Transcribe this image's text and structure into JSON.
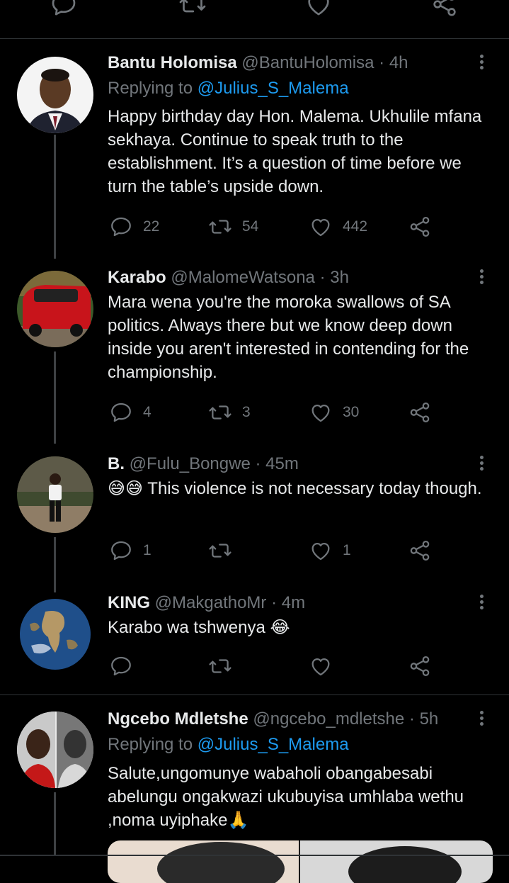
{
  "tweets": [
    {
      "name": "Bantu Holomisa",
      "handle": "@BantuHolomisa",
      "dot": "·",
      "time": "4h",
      "replying_prefix": "Replying to ",
      "replying_to": "@Julius_S_Malema",
      "text": "Happy birthday day Hon. Malema. Ukhulile mfana sekhaya. Continue to speak truth to the establishment. It’s a question of time before we turn the table’s upside down.",
      "replies": "22",
      "retweets": "54",
      "likes": "442",
      "avatar": "portrait-man-suit"
    },
    {
      "name": "Karabo",
      "handle": "@MalomeWatsona",
      "dot": "·",
      "time": "3h",
      "text": "Mara wena you're the moroka swallows of SA politics. Always there but we know deep down inside you aren't interested in contending for the championship.",
      "replies": "4",
      "retweets": "3",
      "likes": "30",
      "avatar": "red-van"
    },
    {
      "name": "B.",
      "handle": "@Fulu_Bongwe",
      "dot": "·",
      "time": "45m",
      "emoji": "😅😅",
      "text": " This violence is not necessary today though.",
      "replies": "1",
      "retweets": "",
      "likes": "1",
      "avatar": "man-standing-outdoors"
    },
    {
      "name": "KING",
      "handle": "@MakgathoMr",
      "dot": "·",
      "time": "4m",
      "text": "Karabo wa tshwenya ",
      "emoji": "😂",
      "replies": "",
      "retweets": "",
      "likes": "",
      "avatar": "earth-globe"
    },
    {
      "name": "Ngcebo Mdletshe",
      "handle": "@ngcebo_mdletshe",
      "dot": "·",
      "time": "5h",
      "replying_prefix": "Replying to ",
      "replying_to": "@Julius_S_Malema",
      "text": "Salute,ungomunye wabaholi obangabesabi abelungu ongakwazi ukubuyisa umhlaba wethu ,noma uyiphake",
      "emoji": "🙏",
      "avatar": "two-men-collage"
    }
  ],
  "icons": {
    "reply": "reply-bubble-icon",
    "retweet": "retweet-icon",
    "like": "heart-icon",
    "share": "share-icon",
    "more": "more-vertical-icon"
  },
  "colors": {
    "background": "#000000",
    "text": "#e7e9ea",
    "muted": "#71767b",
    "accent": "#1d9bf0",
    "divider": "#2f3336"
  }
}
